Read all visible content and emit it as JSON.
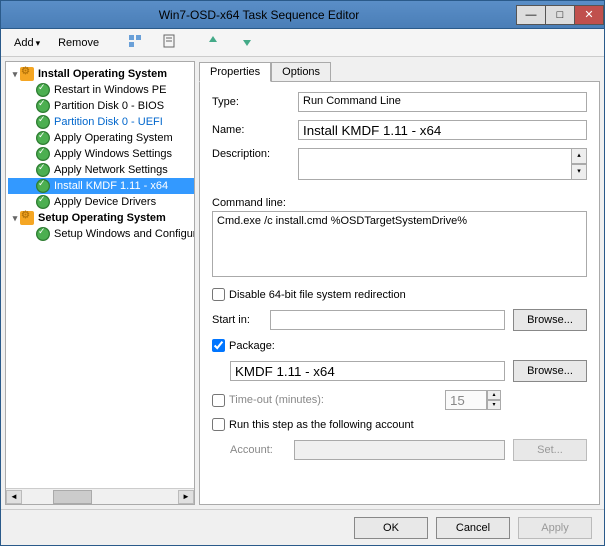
{
  "window": {
    "title": "Win7-OSD-x64 Task Sequence Editor"
  },
  "toolbar": {
    "add": "Add",
    "remove": "Remove"
  },
  "tree": {
    "group1": "Install Operating System",
    "items1": [
      {
        "label": "Restart in Windows PE",
        "link": false
      },
      {
        "label": "Partition Disk 0 - BIOS",
        "link": false
      },
      {
        "label": "Partition Disk 0 - UEFI",
        "link": true
      },
      {
        "label": "Apply Operating System",
        "link": false
      },
      {
        "label": "Apply Windows Settings",
        "link": false
      },
      {
        "label": "Apply Network Settings",
        "link": false
      },
      {
        "label": "Install KMDF 1.11 - x64",
        "link": false,
        "selected": true
      },
      {
        "label": "Apply Device Drivers",
        "link": false
      }
    ],
    "group2": "Setup Operating System",
    "items2": [
      {
        "label": "Setup Windows and Configuration",
        "link": false
      }
    ]
  },
  "tabs": {
    "properties": "Properties",
    "options": "Options"
  },
  "form": {
    "type_label": "Type:",
    "type_value": "Run Command Line",
    "name_label": "Name:",
    "name_value": "Install KMDF 1.11 - x64",
    "desc_label": "Description:",
    "desc_value": "",
    "cmd_label": "Command line:",
    "cmd_value": "Cmd.exe /c install.cmd %OSDTargetSystemDrive%",
    "disable64_label": "Disable 64-bit file system redirection",
    "startin_label": "Start in:",
    "startin_value": "",
    "browse": "Browse...",
    "package_label": "Package:",
    "package_value": "KMDF 1.11 - x64",
    "timeout_label": "Time-out (minutes):",
    "timeout_value": "15",
    "runas_label": "Run this step as the following account",
    "account_label": "Account:",
    "account_value": "",
    "set": "Set..."
  },
  "buttons": {
    "ok": "OK",
    "cancel": "Cancel",
    "apply": "Apply"
  }
}
